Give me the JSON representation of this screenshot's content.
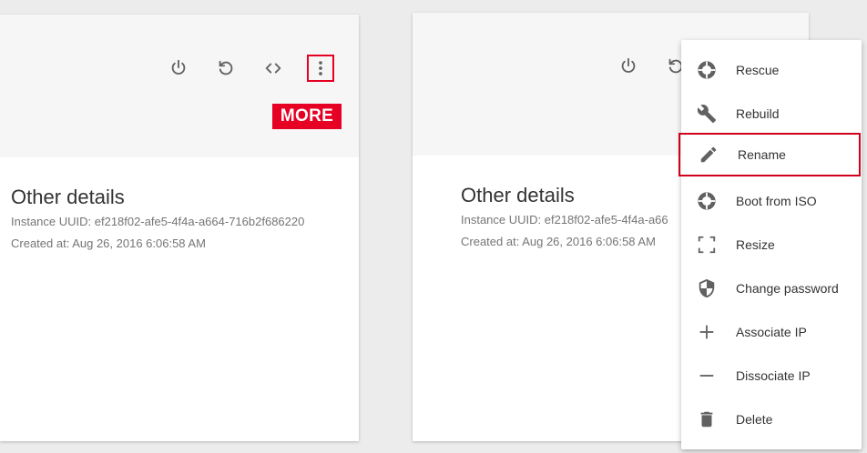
{
  "left_card": {
    "actions": [
      "power-icon",
      "refresh-icon",
      "code-icon",
      "more-vert-icon"
    ],
    "more_tag": "MORE",
    "details_title": "Other details",
    "uuid_line": "Instance UUID: ef218f02-afe5-4f4a-a664-716b2f686220",
    "created_line": "Created at: Aug 26, 2016 6:06:58 AM"
  },
  "right_card": {
    "details_title": "Other details",
    "uuid_line": "Instance UUID: ef218f02-afe5-4f4a-a66",
    "created_line": "Created at: Aug 26, 2016 6:06:58 AM"
  },
  "menu": {
    "items": [
      {
        "label": "Rescue",
        "icon": "lifebuoy-icon"
      },
      {
        "label": "Rebuild",
        "icon": "wrench-icon"
      },
      {
        "label": "Rename",
        "icon": "pencil-icon"
      },
      {
        "label": "Boot from ISO",
        "icon": "disc-icon"
      },
      {
        "label": "Resize",
        "icon": "resize-corners-icon"
      },
      {
        "label": "Change password",
        "icon": "shield-icon"
      },
      {
        "label": "Associate IP",
        "icon": "plus-icon"
      },
      {
        "label": "Dissociate IP",
        "icon": "minus-icon"
      },
      {
        "label": "Delete",
        "icon": "trash-icon"
      }
    ]
  },
  "colors": {
    "accent_red": "#e60023",
    "icon_gray": "#616161",
    "text_gray": "#757575"
  }
}
